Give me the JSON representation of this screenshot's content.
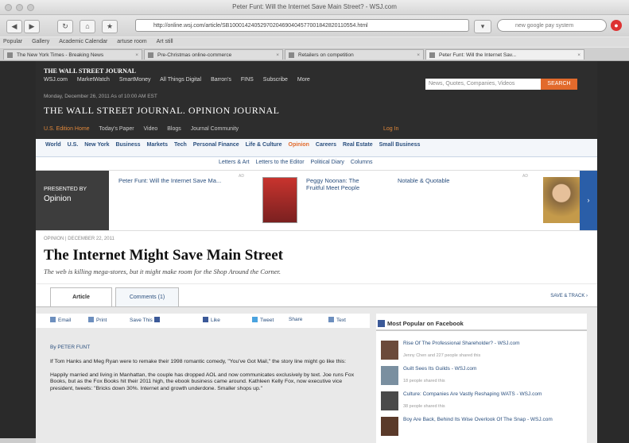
{
  "window": {
    "title": "Peter Funt: Will the Internet Save Main Street? - WSJ.com"
  },
  "toolbar": {
    "back": "◀",
    "forward": "▶",
    "reload": "↻",
    "home": "⌂",
    "url": "http://online.wsj.com/article/SB10001424052970204690404577001842820110554.html",
    "search_placeholder": "new google pay system"
  },
  "bookmarks": [
    "Popular",
    "Gallery",
    "Academic Calendar",
    "artuse room",
    "Art still"
  ],
  "tabs": [
    {
      "label": "The New York Times - Breaking News",
      "active": false
    },
    {
      "label": "Pre-Christmas online-commerce",
      "active": false
    },
    {
      "label": "Retailers on competition",
      "active": false
    },
    {
      "label": "Peter Funt: Will the Internet Sav...",
      "active": true
    }
  ],
  "wsj": {
    "logo_small": "THE WALL STREET JOURNAL",
    "top_links": [
      "WSJ.com",
      "MarketWatch",
      "SmartMoney",
      "All Things Digital",
      "Barron's",
      "FINS",
      "Subscribe",
      "More"
    ],
    "search_placeholder": "News, Quotes, Companies, Videos",
    "search_button": "SEARCH",
    "dateline": "Monday, December 26, 2011  As of 10:00 AM EST",
    "masthead": "THE WALL STREET JOURNAL.  OPINION JOURNAL",
    "edition": "U.S. Edition Home",
    "sub_links": [
      "Today's Paper",
      "Video",
      "Blogs",
      "Journal Community"
    ],
    "login": "Log In"
  },
  "sections": [
    "World",
    "U.S.",
    "New York",
    "Business",
    "Markets",
    "Tech",
    "Personal Finance",
    "Life & Culture",
    "Opinion",
    "Careers",
    "Real Estate",
    "Small Business"
  ],
  "current_section": "Opinion",
  "subsections": [
    "Letters & Art",
    "Letters to the Editor",
    "Political Diary",
    "Columns"
  ],
  "promo": {
    "label_top": "PRESENTED BY",
    "label": "Opinion",
    "item1": "Peter Funt: Will the Internet Save Ma...",
    "item2": "Peggy Noonan: The Fruitful Meet People",
    "item3": "Notable & Quotable",
    "ad1": "AD",
    "ad2": "AD",
    "arrow": "›"
  },
  "article": {
    "breadcrumb": "OPINION  |  DECEMBER 22, 2011",
    "headline": "The Internet Might Save Main Street",
    "dek": "The web is killing mega-stores, but it might make room for the Shop Around the Corner.",
    "tab_article": "Article",
    "tab_comments": "Comments (1)",
    "view_all": "SAVE & TRACK ›",
    "tools": [
      "Email",
      "Print",
      "Save This",
      "Like",
      "Tweet",
      "Share",
      "Text"
    ],
    "byline": "By PETER FUNT",
    "paragraphs": [
      "If Tom Hanks and Meg Ryan were to remake their 1998 romantic comedy, \"You've Got Mail,\" the story line might go like this:",
      "Happily married and living in Manhattan, the couple has dropped AOL and now communicates exclusively by text. Joe runs Fox Books, but as the Fox Books hit their 2011 high, the ebook business came around. Kathleen Kelly Fox, now executive vice president, tweets: \"Bricks down 30%. Internet and growth underdone. Smaller shops up.\""
    ]
  },
  "sidebar": {
    "title": "Most Popular on Facebook",
    "items": [
      {
        "title": "Rise Of The Professional Shareholder? - WSJ.com",
        "sub": "Jenny Chen and 227 people shared this"
      },
      {
        "title": "Guilt Sees Its Guilds - WSJ.com",
        "sub": "18 people shared this"
      },
      {
        "title": "Culture: Companies Are Vastly Reshaping WATS - WSJ.com",
        "sub": "38 people shared this"
      },
      {
        "title": "Boy Are Back, Behind Its Wise Overlook Of The Snap - WSJ.com",
        "sub": ""
      }
    ]
  }
}
